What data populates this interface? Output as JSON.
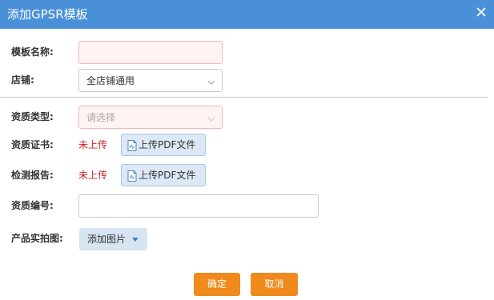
{
  "dialog": {
    "title": "添加GPSR模板",
    "close_icon": "close-icon",
    "header_color": "#4a90d9"
  },
  "form": {
    "template_name": {
      "label": "模板名称:",
      "value": ""
    },
    "store": {
      "label": "店铺:",
      "value": "全店铺通用"
    },
    "qualification_type": {
      "label": "资质类型:",
      "placeholder": "请选择"
    },
    "qualification_cert": {
      "label": "资质证书:",
      "status": "未上传",
      "upload_label": "上传PDF文件"
    },
    "inspection_report": {
      "label": "检测报告:",
      "status": "未上传",
      "upload_label": "上传PDF文件"
    },
    "qualification_number": {
      "label": "资质编号:",
      "value": ""
    },
    "product_photos": {
      "label": "产品实拍图:",
      "button_label": "添加图片"
    }
  },
  "actions": {
    "confirm_label": "确定",
    "cancel_label": "取消",
    "accent_color": "#f08a1c"
  }
}
